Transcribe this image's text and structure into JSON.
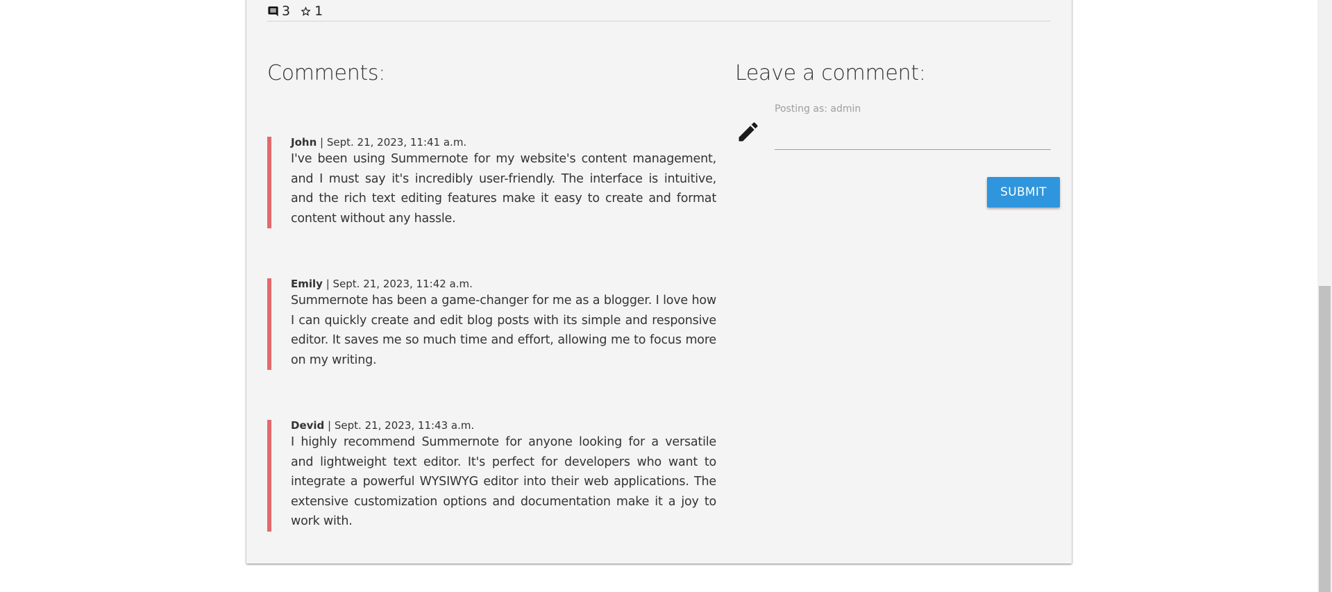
{
  "post_stats": {
    "comment_count": "3",
    "star_count": "1",
    "comment_icon": "comment-icon",
    "star_icon": "star-outline-icon"
  },
  "comments_section": {
    "title": "Comments:",
    "accent_color": "#e26a6f",
    "items": [
      {
        "author": "John",
        "separator": " | ",
        "date": "Sept. 21, 2023, 11:41 a.m.",
        "text": "I've been using Summernote for my website's content management, and I must say it's incredibly user-friendly. The interface is intuitive, and the rich text editing features make it easy to create and format content without any hassle."
      },
      {
        "author": "Emily",
        "separator": " | ",
        "date": "Sept. 21, 2023, 11:42 a.m.",
        "text": "Summernote has been a game-changer for me as a blogger. I love how I can quickly create and edit blog posts with its simple and responsive editor. It saves me so much time and effort, allowing me to focus more on my writing."
      },
      {
        "author": "Devid",
        "separator": " | ",
        "date": "Sept. 21, 2023, 11:43 a.m.",
        "text": "I highly recommend Summernote for anyone looking for a versatile and lightweight text editor. It's perfect for developers who want to integrate a powerful WYSIWYG editor into their web applications. The extensive customization options and documentation make it a joy to work with."
      }
    ]
  },
  "comment_form": {
    "title": "Leave a comment:",
    "icon": "pencil-icon",
    "label": "Posting as: admin",
    "value": "",
    "submit_label": "SUBMIT",
    "submit_color": "#2f95dc"
  }
}
